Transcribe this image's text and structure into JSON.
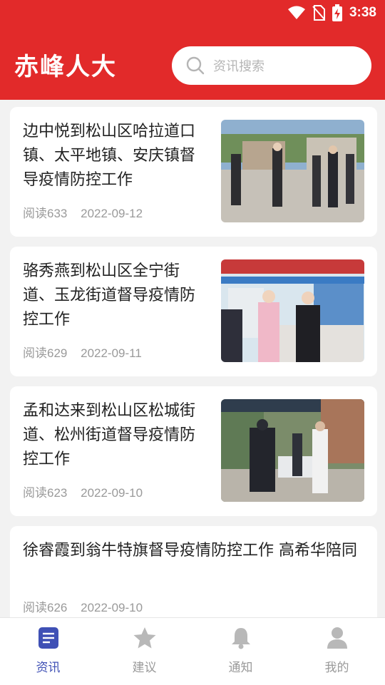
{
  "status": {
    "time": "3:38"
  },
  "header": {
    "title": "赤峰人大",
    "search_placeholder": "资讯搜索"
  },
  "articles": [
    {
      "title": "边中悦到松山区哈拉道口镇、太平地镇、安庆镇督导疫情防控工作",
      "views": "阅读633",
      "date": "2022-09-12"
    },
    {
      "title": "骆秀燕到松山区全宁街道、玉龙街道督导疫情防控工作",
      "views": "阅读629",
      "date": "2022-09-11"
    },
    {
      "title": "孟和达来到松山区松城街道、松州街道督导疫情防控工作",
      "views": "阅读623",
      "date": "2022-09-10"
    },
    {
      "title": "徐睿霞到翁牛特旗督导疫情防控工作 高希华陪同",
      "views": "阅读626",
      "date": "2022-09-10"
    }
  ],
  "tabs": [
    {
      "label": "资讯",
      "icon": "news-icon"
    },
    {
      "label": "建议",
      "icon": "star-icon"
    },
    {
      "label": "通知",
      "icon": "bell-icon"
    },
    {
      "label": "我的",
      "icon": "user-icon"
    }
  ],
  "colors": {
    "brand": "#e22a2a",
    "active_tab": "#3f50b5",
    "inactive_tab": "#b8b8b8"
  }
}
